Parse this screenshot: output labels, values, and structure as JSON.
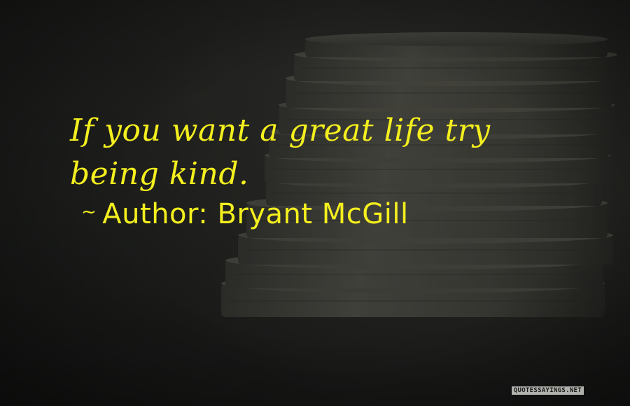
{
  "quote": {
    "text": "If you want a great life try being kind.",
    "tilde": "~",
    "author_label": "Author:",
    "author_name": "Bryant McGill"
  },
  "watermark": {
    "text": "QUOTESSAYINGS.NET"
  },
  "colors": {
    "quote_text": "#f4ef1e",
    "background": "#242522",
    "coin": "#4a4a44"
  }
}
